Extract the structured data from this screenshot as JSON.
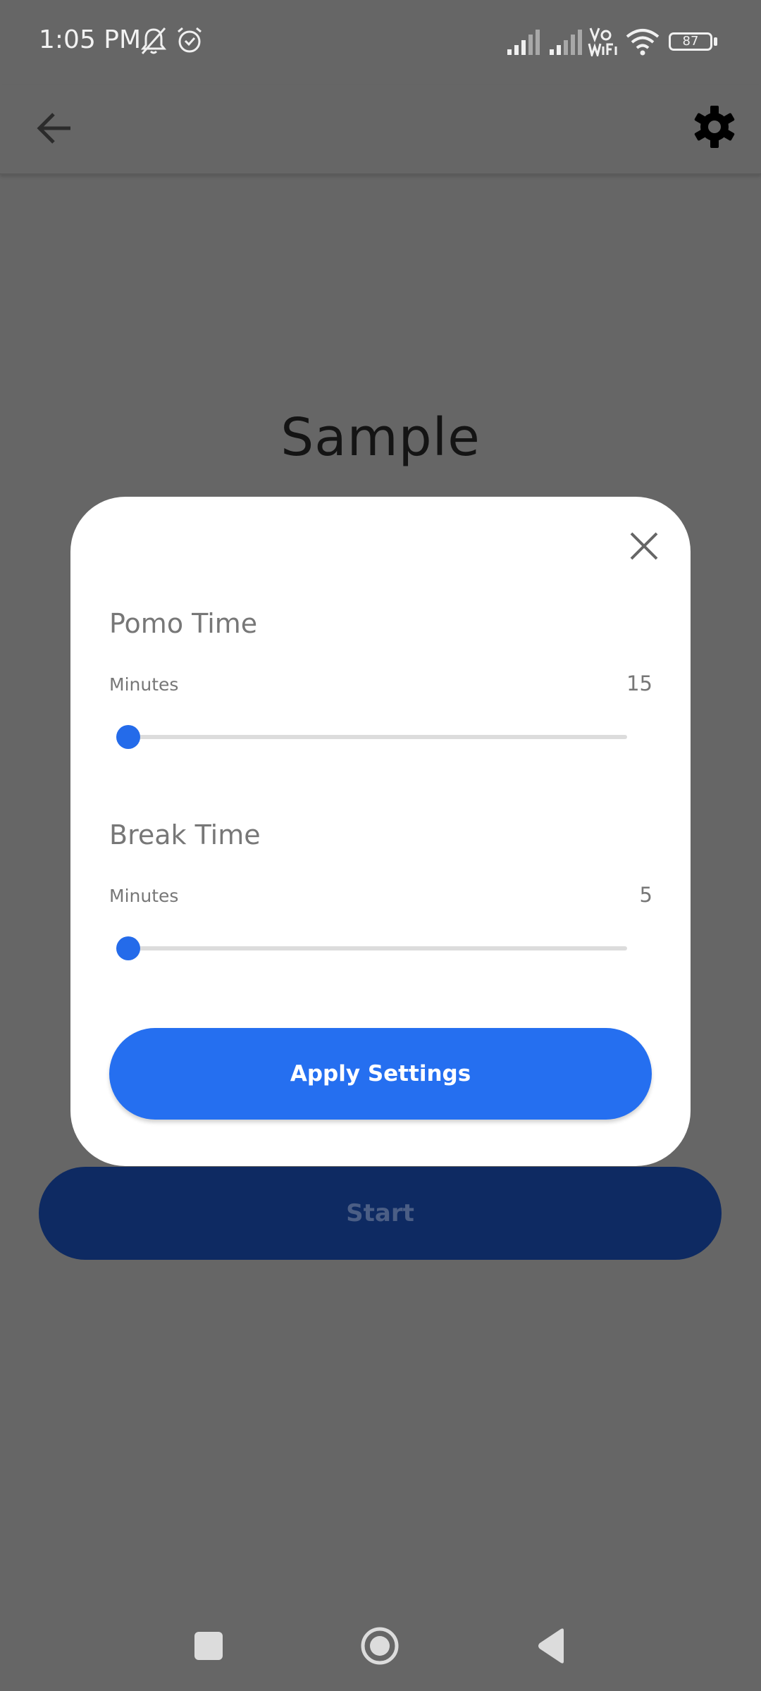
{
  "status_bar": {
    "time": "1:05 PM",
    "battery": "87",
    "icons": [
      "bell-muted-icon",
      "alarm-icon",
      "signal-icon",
      "signal-icon",
      "vowifi-icon",
      "wifi-icon",
      "battery-icon"
    ]
  },
  "app_bar": {
    "back_icon": "arrow-left-icon",
    "settings_icon": "gear-icon"
  },
  "main": {
    "title": "Sample",
    "start_label": "Start"
  },
  "dialog": {
    "close_icon": "close-icon",
    "pomo": {
      "title": "Pomo Time",
      "minutes_label": "Minutes",
      "value": "15",
      "slider_fraction": 0.0
    },
    "break": {
      "title": "Break Time",
      "minutes_label": "Minutes",
      "value": "5",
      "slider_fraction": 0.0
    },
    "apply_label": "Apply Settings"
  },
  "colors": {
    "accent": "#256ff0",
    "scrim_bg": "#666666",
    "start_button": "#0e2a62"
  },
  "nav_bar": {
    "icons": [
      "recents-square-icon",
      "home-circle-icon",
      "back-triangle-icon"
    ]
  }
}
